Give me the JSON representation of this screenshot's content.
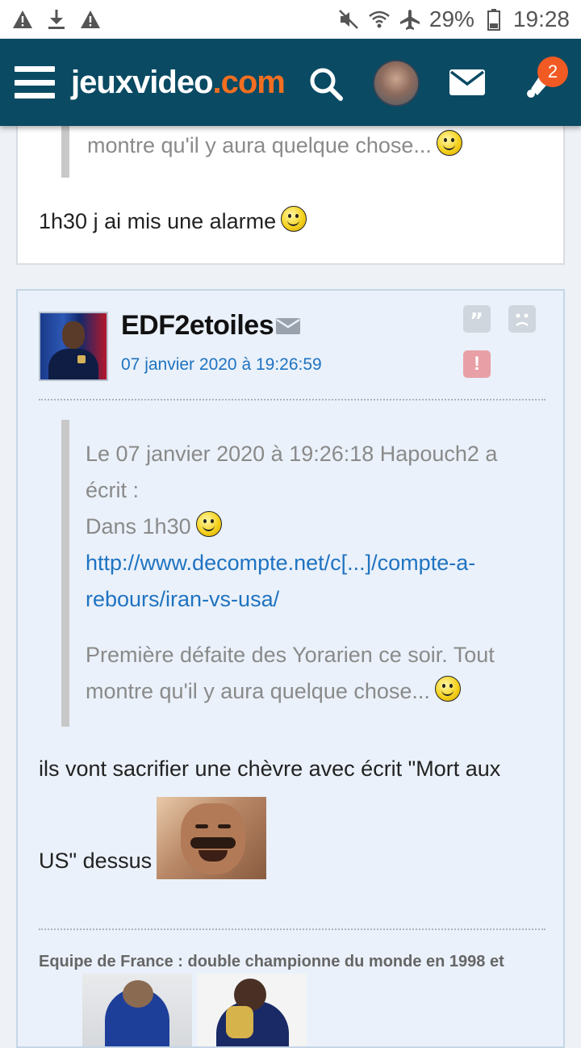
{
  "statusbar": {
    "battery": "29%",
    "time": "19:28"
  },
  "header": {
    "logo_main": "jeuxvideo",
    "logo_tld": ".com",
    "notification_count": "2"
  },
  "colors": {
    "header_bg": "#0a4a63",
    "logo_accent": "#f36f21",
    "badge": "#f25a23",
    "link": "#1f73c1"
  },
  "post_prev": {
    "quote_tail": "montre qu'il y aura quelque chose...",
    "message": "1h30 j ai mis une alarme"
  },
  "post": {
    "username": "EDF2etoiles",
    "date": "07 janvier 2020 à 19:26:59",
    "quote": {
      "header_line1": "Le 07 janvier 2020 à 19:26:18 Hapouch2 a",
      "header_line2": "écrit :",
      "line3": "Dans 1h30",
      "link_line1": "http://www.decompte.net/c[...]/compte-a-",
      "link_line2": "rebours/iran-vs-usa/",
      "para_line1": "Première défaite des Yorarien ce soir. Tout",
      "para_line2": "montre qu'il y aura quelque chose..."
    },
    "message_line1": "ils vont sacrifier une chèvre avec écrit \"Mort aux",
    "message_line2": "US\" dessus",
    "signature": "Equipe de France : double championne du monde en 1998 et"
  }
}
